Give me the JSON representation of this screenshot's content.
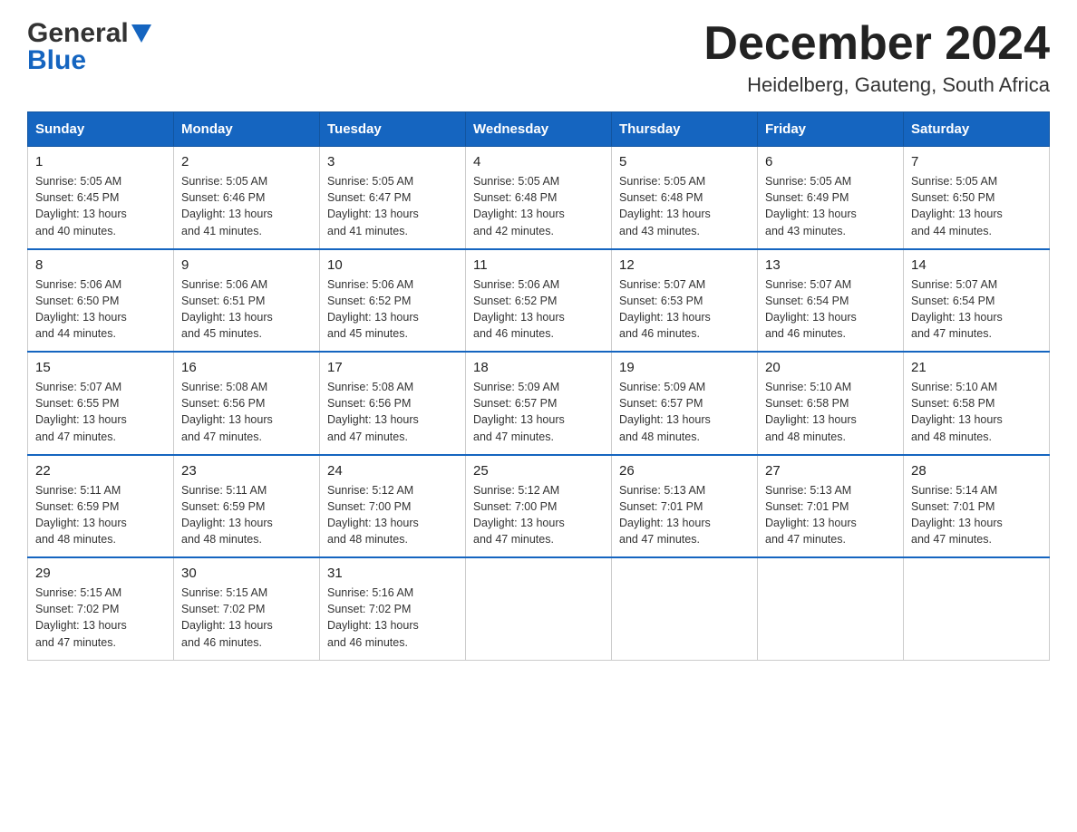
{
  "header": {
    "logo_general": "General",
    "logo_blue": "Blue",
    "title": "December 2024",
    "subtitle": "Heidelberg, Gauteng, South Africa"
  },
  "days_of_week": [
    "Sunday",
    "Monday",
    "Tuesday",
    "Wednesday",
    "Thursday",
    "Friday",
    "Saturday"
  ],
  "weeks": [
    [
      {
        "num": "1",
        "sunrise": "5:05 AM",
        "sunset": "6:45 PM",
        "daylight": "13 hours and 40 minutes."
      },
      {
        "num": "2",
        "sunrise": "5:05 AM",
        "sunset": "6:46 PM",
        "daylight": "13 hours and 41 minutes."
      },
      {
        "num": "3",
        "sunrise": "5:05 AM",
        "sunset": "6:47 PM",
        "daylight": "13 hours and 41 minutes."
      },
      {
        "num": "4",
        "sunrise": "5:05 AM",
        "sunset": "6:48 PM",
        "daylight": "13 hours and 42 minutes."
      },
      {
        "num": "5",
        "sunrise": "5:05 AM",
        "sunset": "6:48 PM",
        "daylight": "13 hours and 43 minutes."
      },
      {
        "num": "6",
        "sunrise": "5:05 AM",
        "sunset": "6:49 PM",
        "daylight": "13 hours and 43 minutes."
      },
      {
        "num": "7",
        "sunrise": "5:05 AM",
        "sunset": "6:50 PM",
        "daylight": "13 hours and 44 minutes."
      }
    ],
    [
      {
        "num": "8",
        "sunrise": "5:06 AM",
        "sunset": "6:50 PM",
        "daylight": "13 hours and 44 minutes."
      },
      {
        "num": "9",
        "sunrise": "5:06 AM",
        "sunset": "6:51 PM",
        "daylight": "13 hours and 45 minutes."
      },
      {
        "num": "10",
        "sunrise": "5:06 AM",
        "sunset": "6:52 PM",
        "daylight": "13 hours and 45 minutes."
      },
      {
        "num": "11",
        "sunrise": "5:06 AM",
        "sunset": "6:52 PM",
        "daylight": "13 hours and 46 minutes."
      },
      {
        "num": "12",
        "sunrise": "5:07 AM",
        "sunset": "6:53 PM",
        "daylight": "13 hours and 46 minutes."
      },
      {
        "num": "13",
        "sunrise": "5:07 AM",
        "sunset": "6:54 PM",
        "daylight": "13 hours and 46 minutes."
      },
      {
        "num": "14",
        "sunrise": "5:07 AM",
        "sunset": "6:54 PM",
        "daylight": "13 hours and 47 minutes."
      }
    ],
    [
      {
        "num": "15",
        "sunrise": "5:07 AM",
        "sunset": "6:55 PM",
        "daylight": "13 hours and 47 minutes."
      },
      {
        "num": "16",
        "sunrise": "5:08 AM",
        "sunset": "6:56 PM",
        "daylight": "13 hours and 47 minutes."
      },
      {
        "num": "17",
        "sunrise": "5:08 AM",
        "sunset": "6:56 PM",
        "daylight": "13 hours and 47 minutes."
      },
      {
        "num": "18",
        "sunrise": "5:09 AM",
        "sunset": "6:57 PM",
        "daylight": "13 hours and 47 minutes."
      },
      {
        "num": "19",
        "sunrise": "5:09 AM",
        "sunset": "6:57 PM",
        "daylight": "13 hours and 48 minutes."
      },
      {
        "num": "20",
        "sunrise": "5:10 AM",
        "sunset": "6:58 PM",
        "daylight": "13 hours and 48 minutes."
      },
      {
        "num": "21",
        "sunrise": "5:10 AM",
        "sunset": "6:58 PM",
        "daylight": "13 hours and 48 minutes."
      }
    ],
    [
      {
        "num": "22",
        "sunrise": "5:11 AM",
        "sunset": "6:59 PM",
        "daylight": "13 hours and 48 minutes."
      },
      {
        "num": "23",
        "sunrise": "5:11 AM",
        "sunset": "6:59 PM",
        "daylight": "13 hours and 48 minutes."
      },
      {
        "num": "24",
        "sunrise": "5:12 AM",
        "sunset": "7:00 PM",
        "daylight": "13 hours and 48 minutes."
      },
      {
        "num": "25",
        "sunrise": "5:12 AM",
        "sunset": "7:00 PM",
        "daylight": "13 hours and 47 minutes."
      },
      {
        "num": "26",
        "sunrise": "5:13 AM",
        "sunset": "7:01 PM",
        "daylight": "13 hours and 47 minutes."
      },
      {
        "num": "27",
        "sunrise": "5:13 AM",
        "sunset": "7:01 PM",
        "daylight": "13 hours and 47 minutes."
      },
      {
        "num": "28",
        "sunrise": "5:14 AM",
        "sunset": "7:01 PM",
        "daylight": "13 hours and 47 minutes."
      }
    ],
    [
      {
        "num": "29",
        "sunrise": "5:15 AM",
        "sunset": "7:02 PM",
        "daylight": "13 hours and 47 minutes."
      },
      {
        "num": "30",
        "sunrise": "5:15 AM",
        "sunset": "7:02 PM",
        "daylight": "13 hours and 46 minutes."
      },
      {
        "num": "31",
        "sunrise": "5:16 AM",
        "sunset": "7:02 PM",
        "daylight": "13 hours and 46 minutes."
      },
      null,
      null,
      null,
      null
    ]
  ],
  "labels": {
    "sunrise": "Sunrise:",
    "sunset": "Sunset:",
    "daylight": "Daylight:"
  }
}
